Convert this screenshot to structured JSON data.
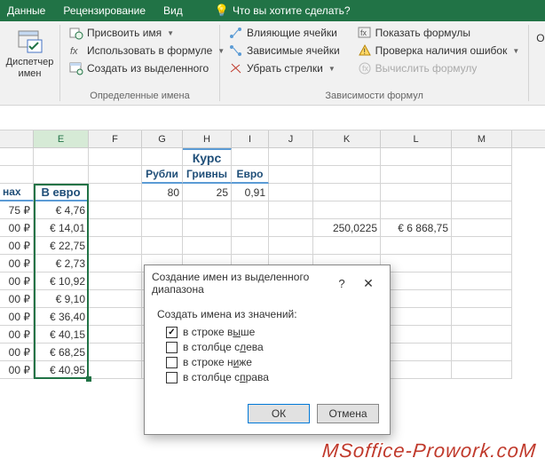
{
  "ribbon": {
    "tabs": {
      "data": "Данные",
      "review": "Рецензирование",
      "view": "Вид"
    },
    "tell_me": "Что вы хотите сделать?",
    "name_manager": "Диспетчер\nимен",
    "btns": {
      "define": "Присвоить имя",
      "use": "Использовать в формуле",
      "create": "Создать из выделенного",
      "trace_prec": "Влияющие ячейки",
      "trace_dep": "Зависимые ячейки",
      "remove": "Убрать стрелки",
      "show_f": "Показать формулы",
      "err_chk": "Проверка наличия ошибок",
      "eval": "Вычислить формулу"
    },
    "groups": {
      "names": "Определенные имена",
      "audit": "Зависимости формул"
    },
    "right": "Окн"
  },
  "grid": {
    "cols": [
      "E",
      "F",
      "G",
      "H",
      "I",
      "J",
      "K",
      "L",
      "M"
    ],
    "r1": {
      "kurs": "Курс"
    },
    "r2": {
      "rub": "Рубли",
      "grv": "Гривны",
      "eur": "Евро"
    },
    "r3": {
      "d": "нах",
      "e": "В евро",
      "g": "80",
      "h": "25",
      "i": "0,91"
    },
    "data_d": [
      "75 ₽",
      "00 ₽",
      "00 ₽",
      "00 ₽",
      "00 ₽",
      "00 ₽",
      "00 ₽",
      "00 ₽",
      "00 ₽",
      "00 ₽"
    ],
    "data_e": [
      "€       4,76",
      "€     14,01",
      "€     22,75",
      "€       2,73",
      "€     10,92",
      "€       9,10",
      "€     36,40",
      "€     40,15",
      "€     68,25",
      "€     40,95"
    ],
    "k": "250,0225",
    "l": "€  6 868,75"
  },
  "dialog": {
    "title": "Создание имен из выделенного диапазона",
    "label": "Создать имена из значений:",
    "opts": {
      "top": {
        "pre": "в строке в",
        "u": "ы",
        "post": "ше"
      },
      "left": {
        "pre": "в столбце с",
        "u": "л",
        "post": "ева"
      },
      "bottom": {
        "pre": "в строке н",
        "u": "и",
        "post": "же"
      },
      "right": {
        "pre": "в столбце с",
        "u": "п",
        "post": "рава"
      }
    },
    "ok": "ОК",
    "cancel": "Отмена"
  },
  "watermark": "MSoffice-Prowork.coM"
}
